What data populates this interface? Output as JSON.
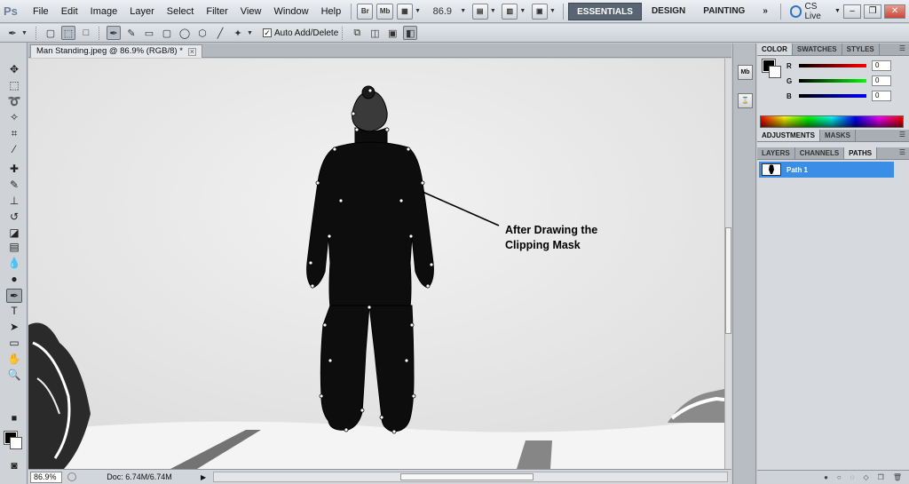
{
  "app": {
    "logo": "Ps"
  },
  "menu": [
    "File",
    "Edit",
    "Image",
    "Layer",
    "Select",
    "Filter",
    "View",
    "Window",
    "Help"
  ],
  "menubar": {
    "bridge": "Br",
    "minibridge": "Mb",
    "zoom": "86.9",
    "workspaces": [
      "ESSENTIALS",
      "DESIGN",
      "PAINTING"
    ],
    "more": "»",
    "cslive": "CS Live"
  },
  "options": {
    "auto_add_delete": "Auto Add/Delete"
  },
  "document": {
    "tab_title": "Man Standing.jpeg @ 86.9% (RGB/8) *"
  },
  "canvas": {
    "annotation_line1": "After Drawing the",
    "annotation_line2": "Clipping Mask"
  },
  "status": {
    "zoom": "86.9%",
    "doc_info": "Doc: 6.74M/6.74M"
  },
  "color_panel": {
    "tabs": [
      "COLOR",
      "SWATCHES",
      "STYLES"
    ],
    "channels": [
      {
        "label": "R",
        "value": "0",
        "color": "#d40000"
      },
      {
        "label": "G",
        "value": "0",
        "color": "#00b000"
      },
      {
        "label": "B",
        "value": "0",
        "color": "#0000d0"
      }
    ]
  },
  "adjust_panel": {
    "tabs": [
      "ADJUSTMENTS",
      "MASKS"
    ]
  },
  "layers_panel": {
    "tabs": [
      "LAYERS",
      "CHANNELS",
      "PATHS"
    ],
    "active_tab": "PATHS",
    "paths": [
      "Path 1"
    ]
  },
  "dock": {
    "top_icon": "Mb"
  }
}
